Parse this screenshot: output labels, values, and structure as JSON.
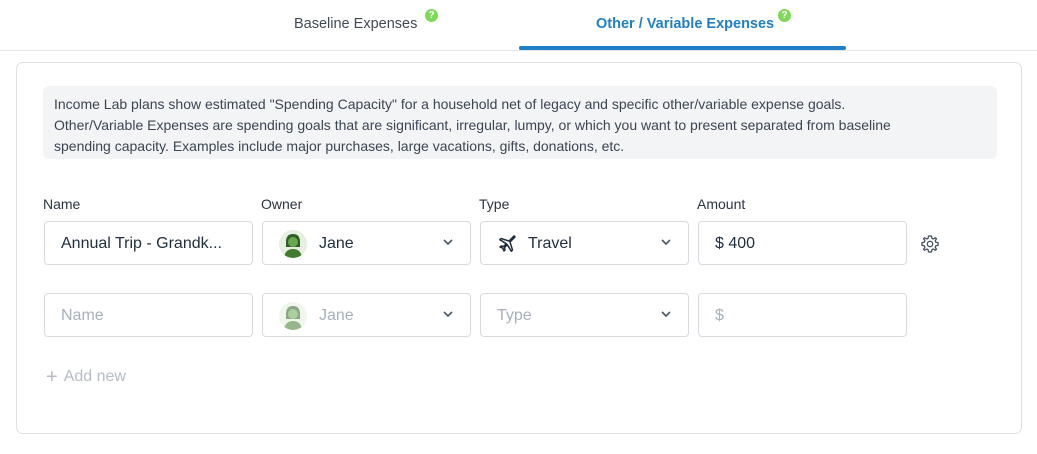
{
  "tabs": [
    {
      "label": "Baseline Expenses",
      "active": false,
      "help": "?"
    },
    {
      "label": "Other / Variable Expenses",
      "active": true,
      "help": "?"
    }
  ],
  "colors": {
    "accent": "#1f7fc4",
    "help_badge": "#7ed957",
    "placeholder": "#a8b0bb"
  },
  "notice": {
    "line1": "Income Lab plans show estimated \"Spending Capacity\" for a household net of legacy and specific other/variable expense goals.",
    "line2": "Other/Variable Expenses are spending goals that are significant, irregular, lumpy, or which you want to present separated from baseline",
    "line3": "spending capacity. Examples include major purchases, large vacations, gifts, donations, etc."
  },
  "columns": {
    "name": "Name",
    "owner": "Owner",
    "type": "Type",
    "amount": "Amount"
  },
  "rows": [
    {
      "name": "Annual Trip - Grandk...",
      "owner": "Jane",
      "type": "Travel",
      "type_icon": "airplane-icon",
      "amount": "$ 400",
      "settings_icon": "gear-icon"
    }
  ],
  "new_row": {
    "name_placeholder": "Name",
    "owner": "Jane",
    "type_placeholder": "Type",
    "amount_placeholder": "$"
  },
  "add_new": {
    "icon": "plus-icon",
    "label": "Add new"
  }
}
